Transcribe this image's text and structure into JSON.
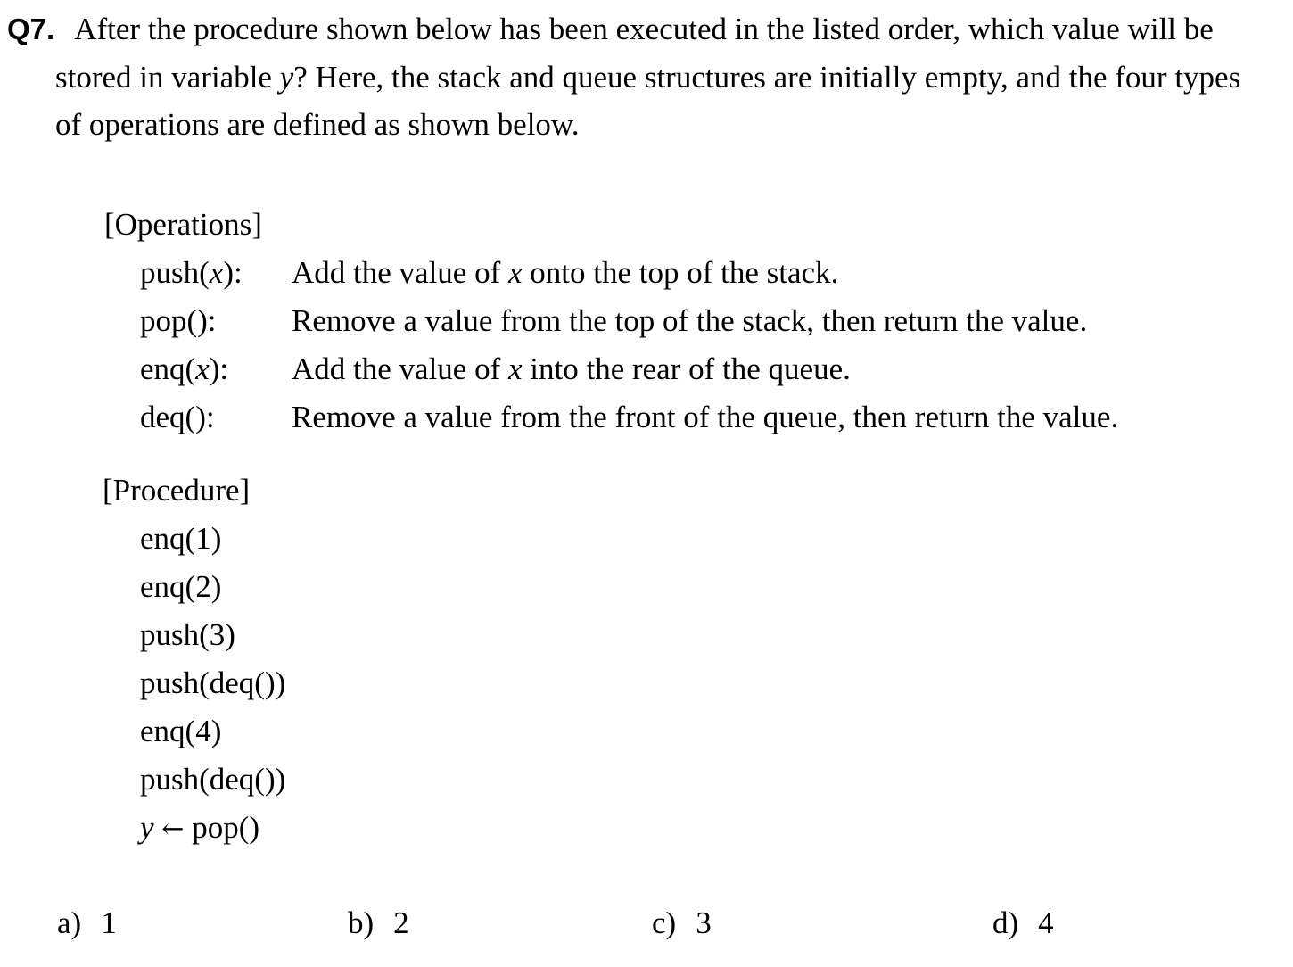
{
  "question": {
    "number": "Q7.",
    "text": [
      "After the procedure shown below has been executed in the listed order, which value will be",
      "stored in variable ",
      "y",
      "? Here, the stack and queue structures are initially empty, and the four types",
      "of operations are defined as shown below."
    ]
  },
  "operations": {
    "heading": "[Operations]",
    "items": [
      {
        "name_pre": "push(",
        "name_var": "x",
        "name_post": "):",
        "desc_pre": "Add the value of ",
        "desc_var": "x",
        "desc_post": " onto the top of the stack."
      },
      {
        "name_pre": "pop():",
        "name_var": "",
        "name_post": "",
        "desc_pre": "Remove a value from the top of the stack, then return the value.",
        "desc_var": "",
        "desc_post": ""
      },
      {
        "name_pre": "enq(",
        "name_var": "x",
        "name_post": "):",
        "desc_pre": "Add the value of ",
        "desc_var": "x",
        "desc_post": " into the rear of the queue."
      },
      {
        "name_pre": "deq():",
        "name_var": "",
        "name_post": "",
        "desc_pre": "Remove a value from the front of the queue, then return the value.",
        "desc_var": "",
        "desc_post": ""
      }
    ]
  },
  "procedure": {
    "heading": "[Procedure]",
    "steps": [
      "enq(1)",
      "enq(2)",
      "push(3)",
      "push(deq())",
      "enq(4)",
      "push(deq())"
    ],
    "last_var": "y",
    "last_arrow": "←",
    "last_call": "pop()"
  },
  "answers": [
    {
      "label": "a)",
      "value": "1"
    },
    {
      "label": "b)",
      "value": "2"
    },
    {
      "label": "c)",
      "value": "3"
    },
    {
      "label": "d)",
      "value": "4"
    }
  ]
}
